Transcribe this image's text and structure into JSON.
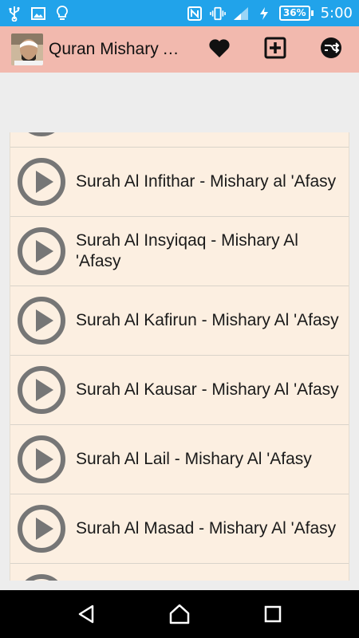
{
  "status_bar": {
    "battery": "36%",
    "time": "5:00",
    "icons": [
      "usb-icon",
      "image-icon",
      "lightbulb-icon",
      "nfc-icon",
      "vibrate-icon",
      "signal-icon",
      "charging-icon",
      "battery-icon"
    ],
    "color": "#21a3ea"
  },
  "action_bar": {
    "title": "Quran Mishary Al 'Afasy",
    "actions": [
      "favorite-heart-icon",
      "add-box-icon",
      "share-icon"
    ],
    "color": "#f2b9ae"
  },
  "list": {
    "items": [
      {
        "title": "Surah Al Infithar - Mishary al 'Afasy"
      },
      {
        "title": "Surah Al Insyiqaq - Mishary Al 'Afasy"
      },
      {
        "title": "Surah Al Kafirun - Mishary Al 'Afasy"
      },
      {
        "title": "Surah Al Kausar - Mishary Al 'Afasy"
      },
      {
        "title": "Surah Al Lail - Mishary Al 'Afasy"
      },
      {
        "title": "Surah Al Masad - Mishary Al 'Afasy"
      }
    ],
    "background": "#fcefe1"
  },
  "nav_bar": {
    "buttons": [
      "back-icon",
      "home-icon",
      "recents-icon"
    ]
  }
}
